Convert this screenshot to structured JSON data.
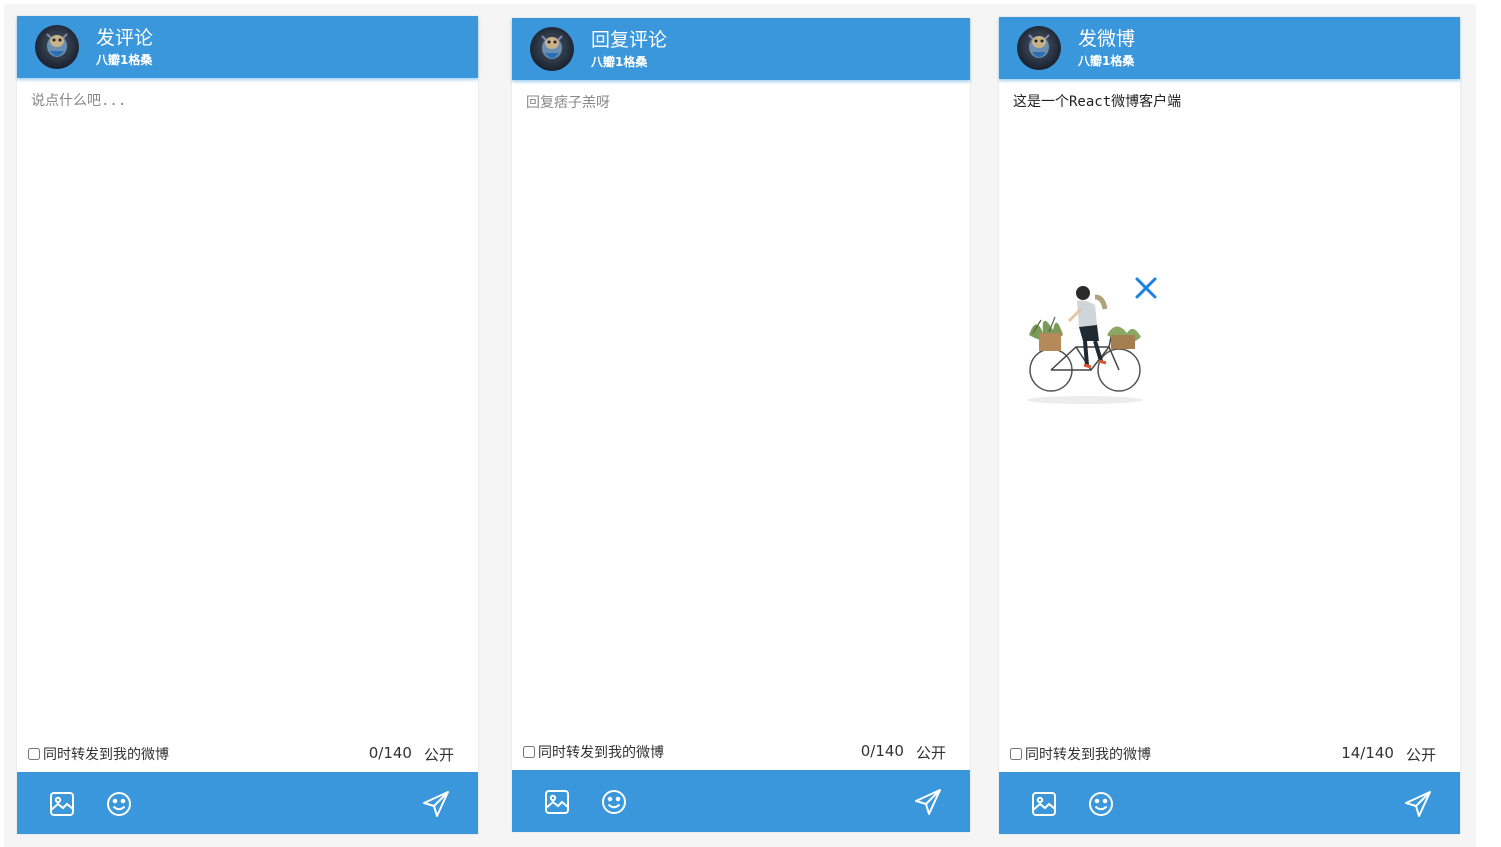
{
  "panels": [
    {
      "title": "发评论",
      "username": "八瓣1格桑",
      "placeholder": "说点什么吧...",
      "text": "",
      "checkbox_label": "同时转发到我的微博",
      "count": "0/140",
      "visibility": "公开"
    },
    {
      "title": "回复评论",
      "username": "八瓣1格桑",
      "placeholder": "回复痞子羔呀",
      "text": "",
      "checkbox_label": "同时转发到我的微博",
      "count": "0/140",
      "visibility": "公开"
    },
    {
      "title": "发微博",
      "username": "八瓣1格桑",
      "placeholder": "",
      "text": "这是一个React微博客户端",
      "checkbox_label": "同时转发到我的微博",
      "count": "14/140",
      "visibility": "公开"
    }
  ],
  "colors": {
    "accent": "#3a97db",
    "remove_icon": "#1a82e2"
  },
  "icons": {
    "avatar": "avatar-image",
    "image": "image-icon",
    "emoji": "smiley-icon",
    "send": "paper-plane-icon",
    "remove": "close-icon",
    "attachment": "cyclist-illustration"
  }
}
